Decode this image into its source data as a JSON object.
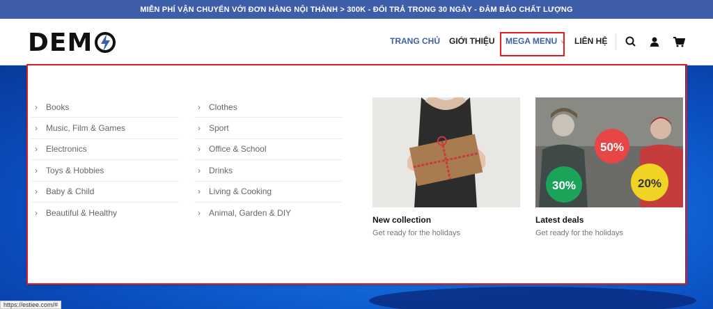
{
  "topbar": {
    "text": "MIỄN PHÍ VẬN CHUYỂN VỚI ĐƠN HÀNG NỘI THÀNH > 300K - ĐỔI TRẢ TRONG 30 NGÀY - ĐẢM BẢO CHẤT LƯỢNG"
  },
  "logo": {
    "text": "DEM"
  },
  "nav": {
    "home": "TRANG CHỦ",
    "about": "GIỚI THIỆU",
    "mega": "MEGA MENU",
    "contact": "LIÊN HỆ"
  },
  "icons": [
    "search-icon",
    "user-icon",
    "cart-icon",
    "chevron-down-icon",
    "chevron-right-icon"
  ],
  "menu": {
    "col1": [
      "Books",
      "Music, Film & Games",
      "Electronics",
      "Toys & Hobbies",
      "Baby & Child",
      "Beautiful & Healthy"
    ],
    "col2": [
      "Clothes",
      "Sport",
      "Office & School",
      "Drinks",
      "Living & Cooking",
      "Animal, Garden & DIY"
    ]
  },
  "promos": [
    {
      "title": "New collection",
      "subtitle": "Get ready for the holidays"
    },
    {
      "title": "Latest deals",
      "subtitle": "Get ready for the holidays",
      "badges": [
        "50%",
        "30%",
        "20%"
      ]
    }
  ],
  "status": {
    "url": "https://estiee.com/#"
  },
  "colors": {
    "accent": "#3f5ea9",
    "highlight": "#e01b22"
  }
}
